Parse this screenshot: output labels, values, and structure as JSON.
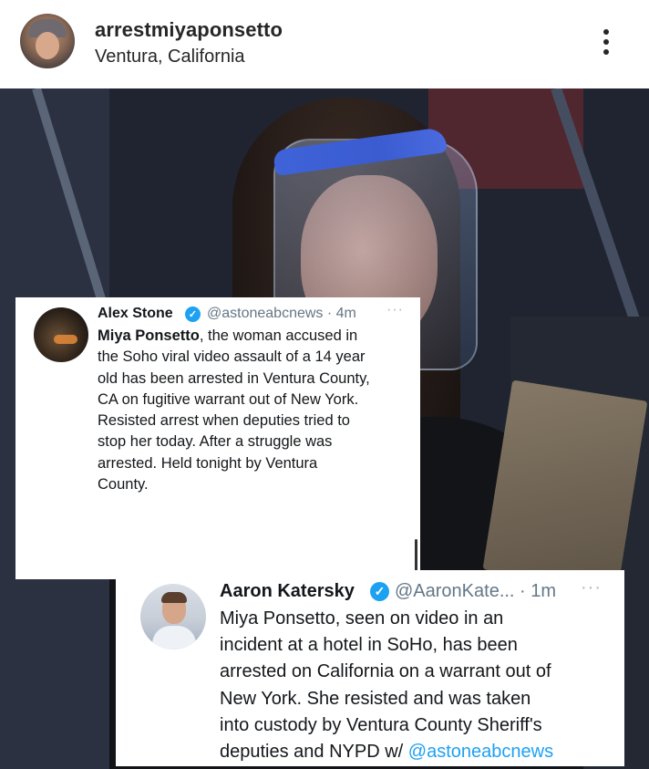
{
  "post": {
    "username": "arrestmiyaponsetto",
    "location": "Ventura, California",
    "more_icon": "more-vertical-icon"
  },
  "tweet1": {
    "name": "Alex Stone",
    "handle_time": "@astoneabcnews · 4m",
    "more": "···",
    "verified_icon": "check",
    "lines": [
      {
        "bold": "Miya Ponsetto",
        "text": ", the woman accused in"
      },
      {
        "bold": "",
        "text": "the Soho viral video assault of a 14 year"
      },
      {
        "bold": "",
        "text": "old has been arrested in Ventura County,"
      },
      {
        "bold": "",
        "text": "CA on fugitive warrant out of New York."
      },
      {
        "bold": "",
        "text": "Resisted arrest when deputies tried to"
      },
      {
        "bold": "",
        "text": "stop her today. After a struggle was"
      },
      {
        "bold": "",
        "text": "arrested. Held tonight by Ventura"
      },
      {
        "bold": "",
        "text": "County."
      }
    ]
  },
  "tweet2": {
    "name": "Aaron Katersky",
    "handle_time": "@AaronKate... · 1m",
    "more": "···",
    "verified_icon": "check",
    "lines": [
      "Miya Ponsetto, seen on video in an",
      "incident at a hotel in SoHo, has been",
      "arrested on California on a warrant out of",
      "New York. She resisted and was taken",
      "into custody by Ventura County Sheriff's",
      "deputies and NYPD w/ "
    ],
    "mention": "@astoneabcnews"
  },
  "colors": {
    "verified": "#1da1f2",
    "link": "#1da1f2",
    "handle": "#657786"
  }
}
